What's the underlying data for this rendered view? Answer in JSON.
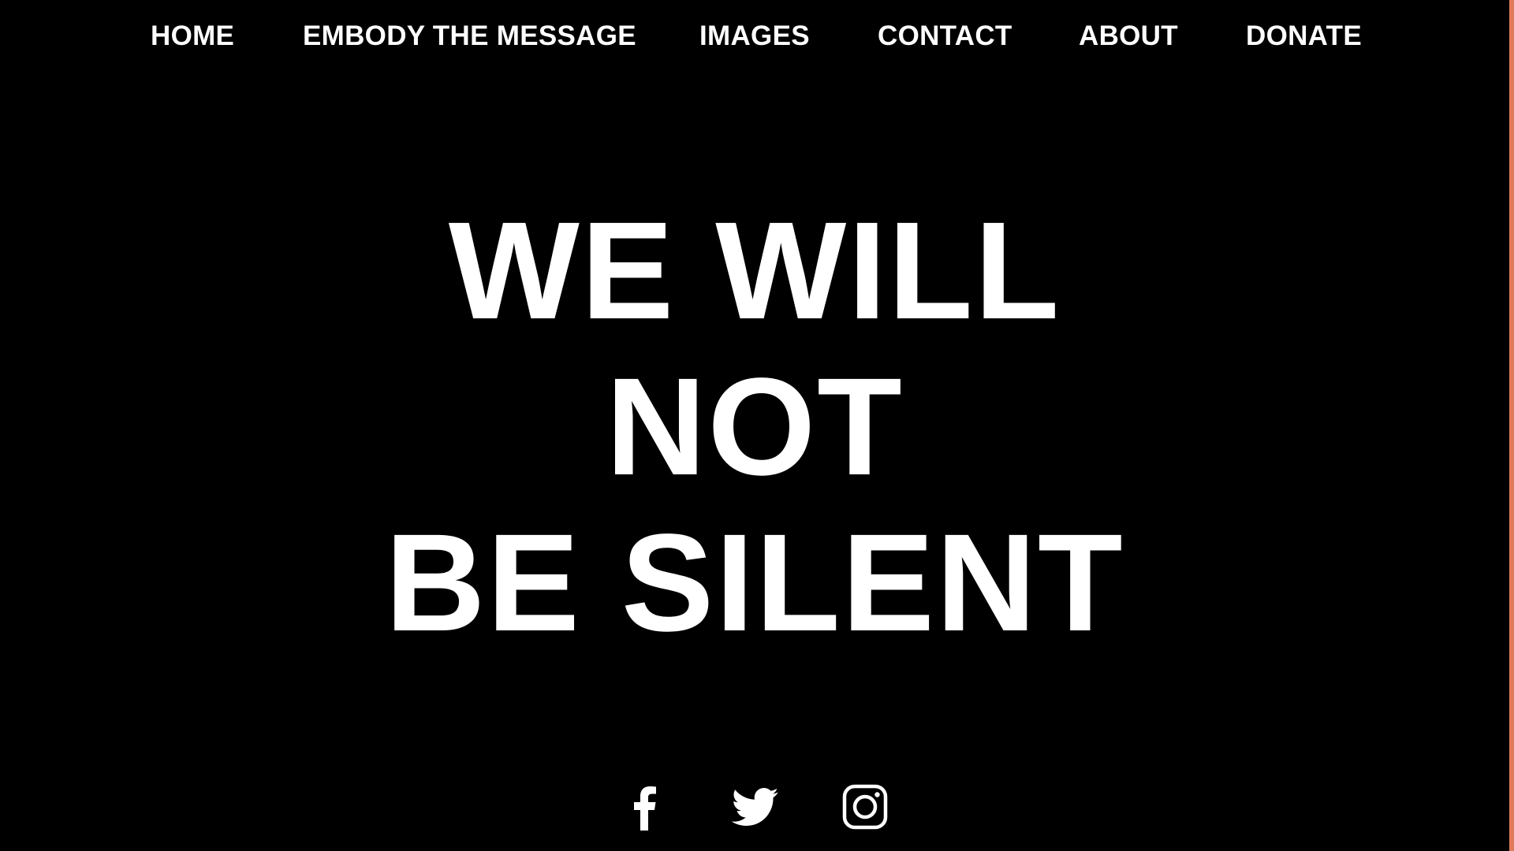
{
  "nav": {
    "items": [
      {
        "label": "HOME"
      },
      {
        "label": "EMBODY THE MESSAGE"
      },
      {
        "label": "IMAGES"
      },
      {
        "label": "CONTACT"
      },
      {
        "label": "ABOUT"
      },
      {
        "label": "DONATE"
      }
    ]
  },
  "hero": {
    "lines": [
      "WE WILL",
      "NOT",
      "BE SILENT"
    ]
  },
  "social": {
    "icons": [
      "facebook-icon",
      "twitter-icon",
      "instagram-icon"
    ]
  },
  "colors": {
    "background": "#000000",
    "text": "#ffffff",
    "edge_accent": "#e07a5a"
  }
}
